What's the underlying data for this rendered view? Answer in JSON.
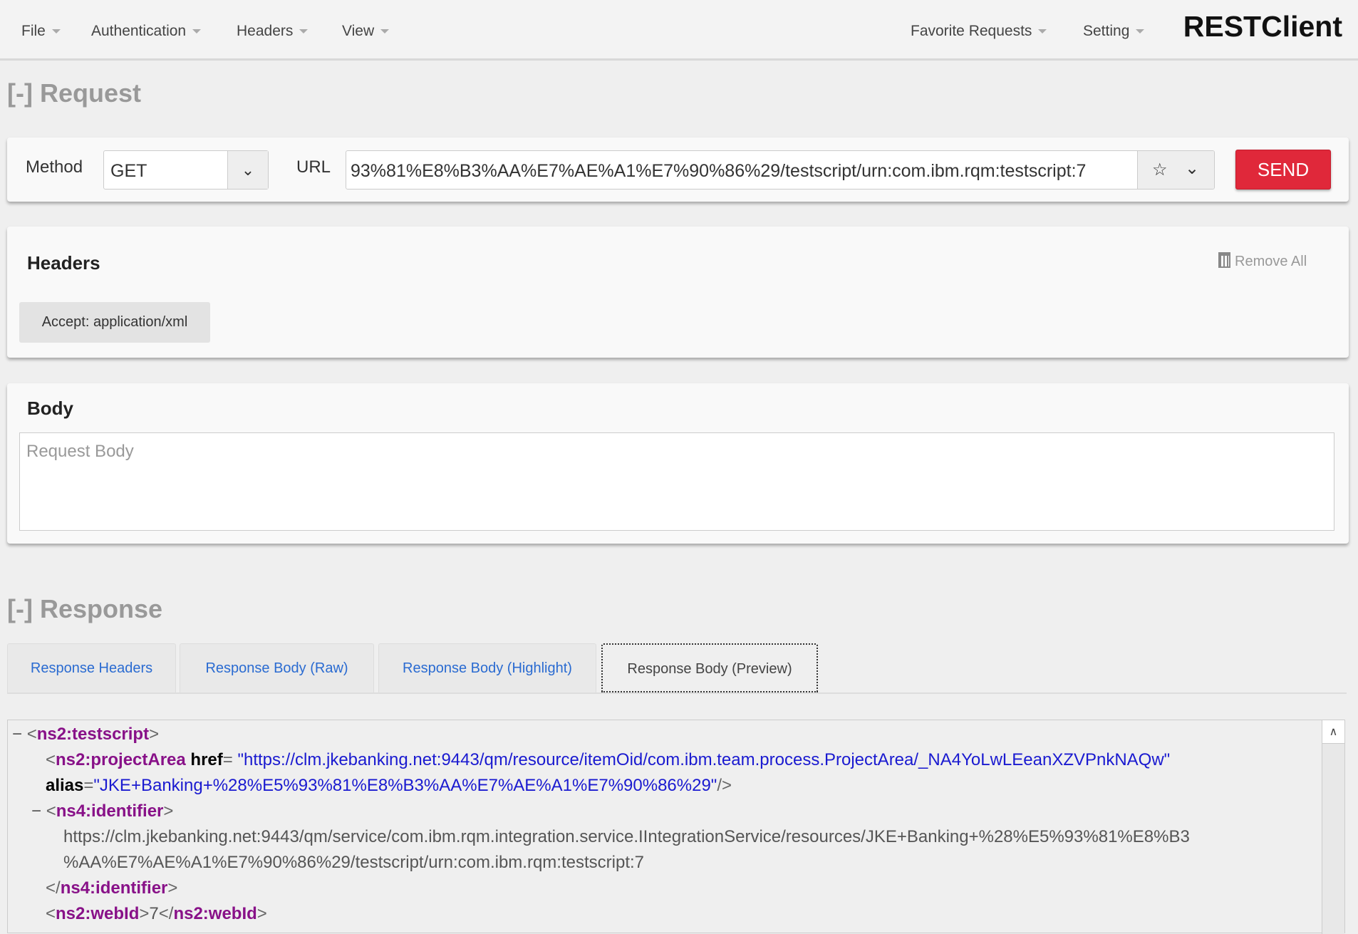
{
  "nav": {
    "menus": [
      "File",
      "Authentication",
      "Headers",
      "View"
    ],
    "right_menus": [
      "Favorite Requests",
      "Setting"
    ],
    "brand": "RESTClient"
  },
  "request": {
    "title": "[-] Request",
    "method_label": "Method",
    "method": "GET",
    "url_label": "URL",
    "url": "93%81%E8%B3%AA%E7%AE%A1%E7%90%86%29/testscript/urn:com.ibm.rqm:testscript:7",
    "send": "SEND"
  },
  "headers": {
    "title": "Headers",
    "remove_all": "Remove All",
    "items": [
      "Accept: application/xml"
    ]
  },
  "body": {
    "title": "Body",
    "placeholder": "Request Body"
  },
  "response": {
    "title": "[-] Response",
    "tabs": [
      "Response Headers",
      "Response Body (Raw)",
      "Response Body (Highlight)",
      "Response Body (Preview)"
    ],
    "active_tab": 3,
    "xml": {
      "l1_toggle": "−",
      "l1_tag": "ns2:testscript",
      "l2_tag": "ns2:projectArea",
      "l2_attr": "href",
      "l2_val": "\"https://clm.jkebanking.net:9443/qm/resource/itemOid/com.ibm.team.process.ProjectArea/_NA4YoLwLEeanXZVPnkNAQw\"",
      "l3_attr": "alias",
      "l3_val": "\"JKE+Banking+%28%E5%93%81%E8%B3%AA%E7%AE%A1%E7%90%86%29\"",
      "l4_toggle": "−",
      "l4_tag": "ns4:identifier",
      "l5_text": "https://clm.jkebanking.net:9443/qm/service/com.ibm.rqm.integration.service.IIntegrationService/resources/JKE+Banking+%28%E5%93%81%E8%B3",
      "l6_text": "%AA%E7%AE%A1%E7%90%86%29/testscript/urn:com.ibm.rqm:testscript:7",
      "l7_tag": "ns4:identifier",
      "l8_tag": "ns2:webId",
      "l8_text": "7"
    }
  },
  "colors": {
    "send": "#e0283a",
    "tag": "#881188",
    "attr_value": "#1a1ad0",
    "tab_link": "#2a6bd1"
  }
}
